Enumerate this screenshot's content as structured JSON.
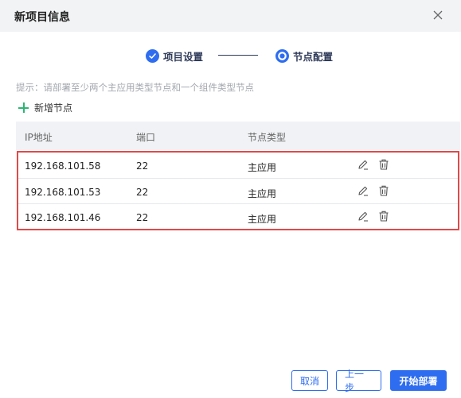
{
  "dialog": {
    "title": "新项目信息",
    "close_icon": "close-icon"
  },
  "steps": [
    {
      "label": "项目设置",
      "state": "done",
      "icon": "check-circle-icon"
    },
    {
      "label": "节点配置",
      "state": "current",
      "icon": "dot-circle-icon"
    }
  ],
  "hint": "提示：请部署至少两个主应用类型节点和一个组件类型节点",
  "add_node": {
    "label": "新增节点",
    "icon": "plus-icon"
  },
  "table": {
    "headers": [
      "IP地址",
      "端口",
      "节点类型"
    ],
    "rows": [
      {
        "ip": "192.168.101.58",
        "port": "22",
        "type": "主应用"
      },
      {
        "ip": "192.168.101.53",
        "port": "22",
        "type": "主应用"
      },
      {
        "ip": "192.168.101.46",
        "port": "22",
        "type": "主应用"
      }
    ],
    "row_actions": [
      "edit-icon",
      "delete-icon"
    ]
  },
  "footer": {
    "cancel": "取消",
    "prev": "上一步",
    "deploy": "开始部署"
  },
  "colors": {
    "primary": "#2e6df0",
    "add": "#2bb673",
    "highlight_border": "#e04a4a",
    "header_bg": "#f2f3f5"
  }
}
